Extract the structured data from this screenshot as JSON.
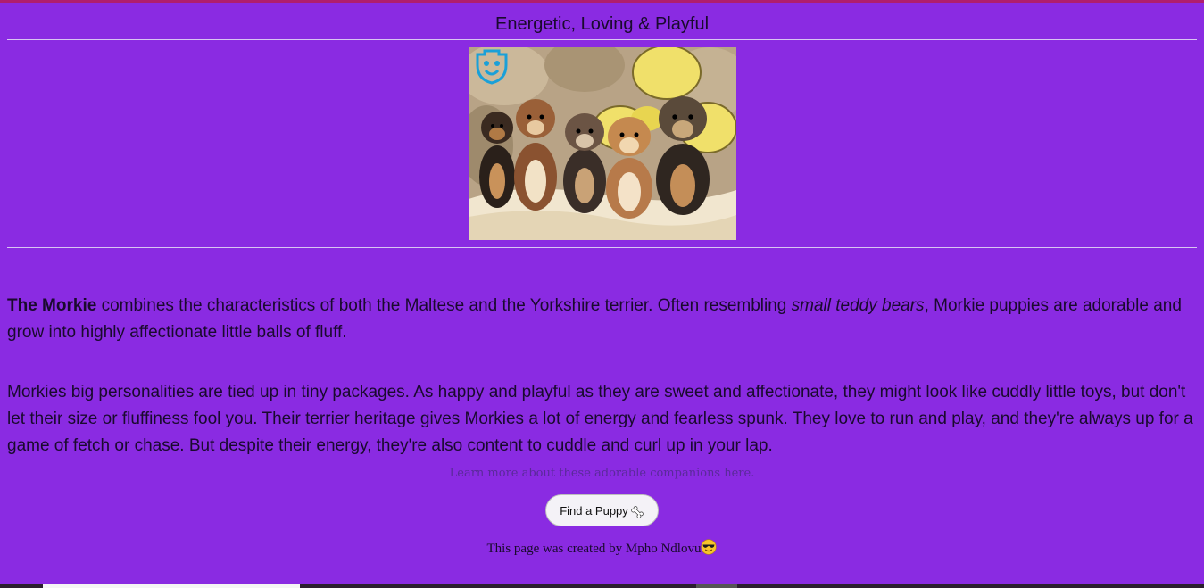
{
  "page": {
    "subtitle": "Energetic, Loving & Playful",
    "image_alt": "Five Morkie puppies sitting in a row"
  },
  "intro": {
    "bold": "The Morkie",
    "text_before_italic": " combines the characteristics of both the Maltese and the Yorkshire terrier. Often resembling ",
    "italic": "small teddy bears",
    "text_after_italic": ", Morkie puppies are adorable and grow into highly affectionate little balls of fluff."
  },
  "body": {
    "paragraph": "Morkies big personalities are tied up in tiny packages. As happy and playful as they are sweet and affectionate, they might look like cuddly little toys, but don't let their size or fluffiness fool you. Their terrier heritage gives Morkies a lot of energy and fearless spunk. They love to run and play, and they're always up for a game of fetch or chase. But despite their energy, they're also content to cuddle and curl up in your lap."
  },
  "links": {
    "learn_more": "Learn more about these adorable companions here."
  },
  "actions": {
    "find_puppy_label": "Find a Puppy",
    "button_icon": "bone-icon"
  },
  "footer": {
    "credit": "This page was created by Mpho Ndlovu",
    "credit_icon": "sunglasses-emoji-icon"
  },
  "colors": {
    "background": "#8a2be2",
    "top_strip": "#b01e6e",
    "text": "#1a0a2e",
    "link": "#5a2a9a",
    "button_bg": "#f4f2f7"
  }
}
